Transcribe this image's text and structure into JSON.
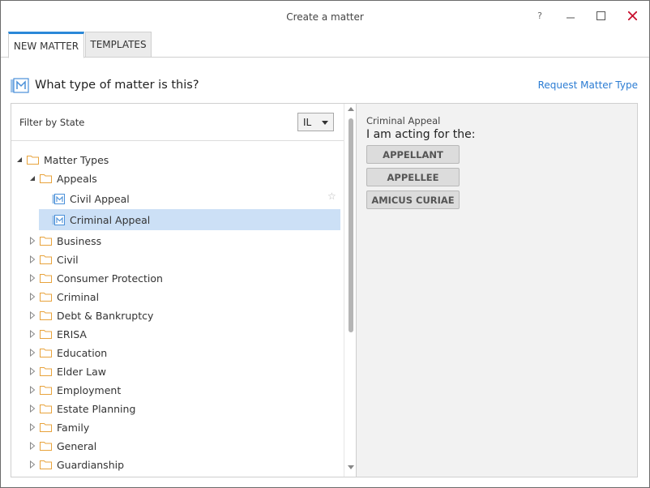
{
  "window": {
    "title": "Create a matter",
    "help_label": "?",
    "min_label": "—",
    "max_label": "☐",
    "close_label": "✕"
  },
  "tabs": [
    {
      "label": "NEW MATTER",
      "active": true
    },
    {
      "label": "TEMPLATES",
      "active": false
    }
  ],
  "header": {
    "question": "What type of matter is this?",
    "request_link": "Request Matter Type"
  },
  "filter": {
    "label": "Filter by State",
    "state_value": "IL"
  },
  "tree": {
    "root": "Matter Types",
    "appeals": {
      "label": "Appeals",
      "children": [
        "Civil Appeal",
        "Criminal Appeal"
      ]
    },
    "categories": [
      "Business",
      "Civil",
      "Consumer Protection",
      "Criminal",
      "Debt & Bankruptcy",
      "ERISA",
      "Education",
      "Elder Law",
      "Employment",
      "Estate Planning",
      "Family",
      "General",
      "Guardianship"
    ],
    "selected": "Criminal Appeal"
  },
  "detail": {
    "title": "Criminal Appeal",
    "subtitle": "I am acting for the:",
    "roles": [
      "APPELLANT",
      "APPELLEE",
      "AMICUS CURIAE"
    ]
  },
  "colors": {
    "accent": "#2b88d8",
    "link": "#2b7cd3",
    "close": "#c8102e",
    "folder": "#e8a33c",
    "selected_row": "#cce0f6"
  },
  "icons": {
    "matter": "matter-m-icon",
    "folder": "folder-icon",
    "star": "star-outline-icon"
  }
}
